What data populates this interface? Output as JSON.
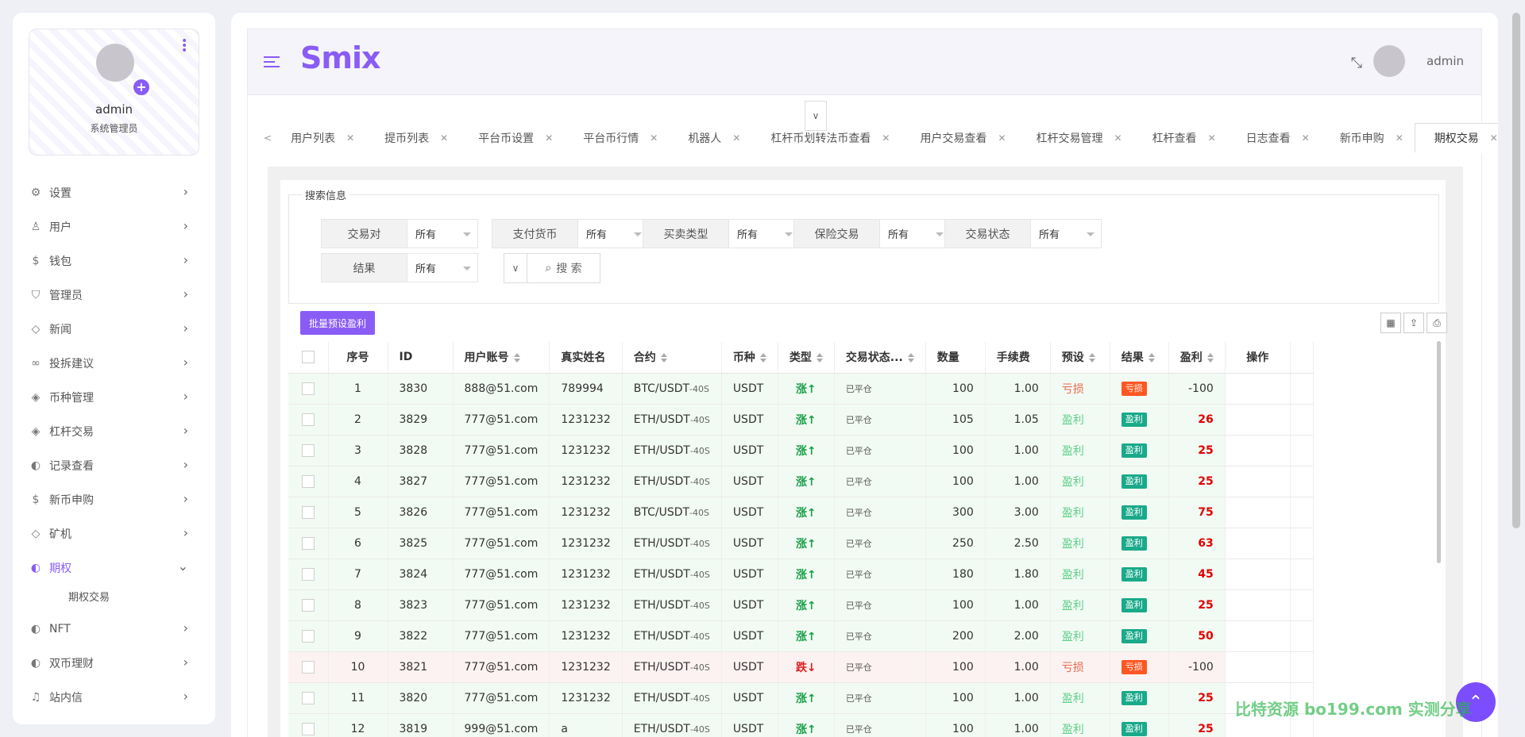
{
  "profile": {
    "name": "admin",
    "role": "系统管理员"
  },
  "menu": [
    {
      "label": "设置",
      "icon": "gear-icon",
      "glyph": "⚙",
      "active": false,
      "expanded": false
    },
    {
      "label": "用户",
      "icon": "user-icon",
      "glyph": "♙",
      "active": false,
      "expanded": false
    },
    {
      "label": "钱包",
      "icon": "dollar-icon",
      "glyph": "$",
      "active": false,
      "expanded": false
    },
    {
      "label": "管理员",
      "icon": "shield-icon",
      "glyph": "⛉",
      "active": false,
      "expanded": false
    },
    {
      "label": "新闻",
      "icon": "tag-icon",
      "glyph": "◇",
      "active": false,
      "expanded": false
    },
    {
      "label": "投拆建议",
      "icon": "infinity-icon",
      "glyph": "∞",
      "active": false,
      "expanded": false
    },
    {
      "label": "币种管理",
      "icon": "diamond-icon",
      "glyph": "◈",
      "active": false,
      "expanded": false
    },
    {
      "label": "杠杆交易",
      "icon": "diamond-icon",
      "glyph": "◈",
      "active": false,
      "expanded": false
    },
    {
      "label": "记录查看",
      "icon": "record-icon",
      "glyph": "◐",
      "active": false,
      "expanded": false
    },
    {
      "label": "新币申购",
      "icon": "dollar-icon",
      "glyph": "$",
      "active": false,
      "expanded": false
    },
    {
      "label": "矿机",
      "icon": "tag-icon",
      "glyph": "◇",
      "active": false,
      "expanded": false
    },
    {
      "label": "期权",
      "icon": "record-icon",
      "glyph": "◐",
      "active": true,
      "expanded": true,
      "children": [
        "期权交易"
      ]
    },
    {
      "label": "NFT",
      "icon": "record-icon",
      "glyph": "◐",
      "active": false,
      "expanded": false
    },
    {
      "label": "双币理财",
      "icon": "record-icon",
      "glyph": "◐",
      "active": false,
      "expanded": false
    },
    {
      "label": "站内信",
      "icon": "bell-icon",
      "glyph": "♫",
      "active": false,
      "expanded": false
    }
  ],
  "header": {
    "brand": "Smix",
    "username": "admin"
  },
  "tabs": [
    "用户列表",
    "提币列表",
    "平台币设置",
    "平台币行情",
    "机器人",
    "杠杆币划转法币查看",
    "用户交易查看",
    "杠杆交易管理",
    "杠杆查看",
    "日志查看",
    "新币申购",
    "期权交易"
  ],
  "active_tab": "期权交易",
  "search": {
    "title": "搜索信息",
    "fields": [
      {
        "label": "交易对",
        "value": "所有"
      },
      {
        "label": "支付货币",
        "value": "所有"
      },
      {
        "label": "买卖类型",
        "value": "所有"
      },
      {
        "label": "保险交易",
        "value": "所有"
      },
      {
        "label": "交易状态",
        "value": "所有"
      },
      {
        "label": "结果",
        "value": "所有"
      }
    ],
    "button": "搜 索"
  },
  "toolbar": {
    "batch_label": "批量预设盈利"
  },
  "table": {
    "columns": [
      "序号",
      "ID",
      "用户账号",
      "真实姓名",
      "合约",
      "币种",
      "类型",
      "交易状态...",
      "数量",
      "手续费",
      "预设",
      "结果",
      "盈利",
      "操作"
    ],
    "rows": [
      {
        "no": "1",
        "id": "3830",
        "account": "888@51.com",
        "name": "789994",
        "contract": "BTC/USDT",
        "period": "-40S",
        "coin": "USDT",
        "type": "涨↑",
        "dir": "up",
        "status": "已平仓",
        "qty": "100",
        "fee": "1.00",
        "preset": "亏损",
        "result": "亏损",
        "profit": "-100",
        "win": false,
        "row_tone": "win"
      },
      {
        "no": "2",
        "id": "3829",
        "account": "777@51.com",
        "name": "1231232",
        "contract": "ETH/USDT",
        "period": "-40S",
        "coin": "USDT",
        "type": "涨↑",
        "dir": "up",
        "status": "已平仓",
        "qty": "105",
        "fee": "1.05",
        "preset": "盈利",
        "result": "盈利",
        "profit": "26",
        "win": true,
        "row_tone": "win"
      },
      {
        "no": "3",
        "id": "3828",
        "account": "777@51.com",
        "name": "1231232",
        "contract": "ETH/USDT",
        "period": "-40S",
        "coin": "USDT",
        "type": "涨↑",
        "dir": "up",
        "status": "已平仓",
        "qty": "100",
        "fee": "1.00",
        "preset": "盈利",
        "result": "盈利",
        "profit": "25",
        "win": true,
        "row_tone": "win"
      },
      {
        "no": "4",
        "id": "3827",
        "account": "777@51.com",
        "name": "1231232",
        "contract": "ETH/USDT",
        "period": "-40S",
        "coin": "USDT",
        "type": "涨↑",
        "dir": "up",
        "status": "已平仓",
        "qty": "100",
        "fee": "1.00",
        "preset": "盈利",
        "result": "盈利",
        "profit": "25",
        "win": true,
        "row_tone": "win"
      },
      {
        "no": "5",
        "id": "3826",
        "account": "777@51.com",
        "name": "1231232",
        "contract": "BTC/USDT",
        "period": "-40S",
        "coin": "USDT",
        "type": "涨↑",
        "dir": "up",
        "status": "已平仓",
        "qty": "300",
        "fee": "3.00",
        "preset": "盈利",
        "result": "盈利",
        "profit": "75",
        "win": true,
        "row_tone": "win"
      },
      {
        "no": "6",
        "id": "3825",
        "account": "777@51.com",
        "name": "1231232",
        "contract": "ETH/USDT",
        "period": "-40S",
        "coin": "USDT",
        "type": "涨↑",
        "dir": "up",
        "status": "已平仓",
        "qty": "250",
        "fee": "2.50",
        "preset": "盈利",
        "result": "盈利",
        "profit": "63",
        "win": true,
        "row_tone": "win"
      },
      {
        "no": "7",
        "id": "3824",
        "account": "777@51.com",
        "name": "1231232",
        "contract": "ETH/USDT",
        "period": "-40S",
        "coin": "USDT",
        "type": "涨↑",
        "dir": "up",
        "status": "已平仓",
        "qty": "180",
        "fee": "1.80",
        "preset": "盈利",
        "result": "盈利",
        "profit": "45",
        "win": true,
        "row_tone": "win"
      },
      {
        "no": "8",
        "id": "3823",
        "account": "777@51.com",
        "name": "1231232",
        "contract": "ETH/USDT",
        "period": "-40S",
        "coin": "USDT",
        "type": "涨↑",
        "dir": "up",
        "status": "已平仓",
        "qty": "100",
        "fee": "1.00",
        "preset": "盈利",
        "result": "盈利",
        "profit": "25",
        "win": true,
        "row_tone": "win"
      },
      {
        "no": "9",
        "id": "3822",
        "account": "777@51.com",
        "name": "1231232",
        "contract": "ETH/USDT",
        "period": "-40S",
        "coin": "USDT",
        "type": "涨↑",
        "dir": "up",
        "status": "已平仓",
        "qty": "200",
        "fee": "2.00",
        "preset": "盈利",
        "result": "盈利",
        "profit": "50",
        "win": true,
        "row_tone": "win"
      },
      {
        "no": "10",
        "id": "3821",
        "account": "777@51.com",
        "name": "1231232",
        "contract": "ETH/USDT",
        "period": "-40S",
        "coin": "USDT",
        "type": "跌↓",
        "dir": "down",
        "status": "已平仓",
        "qty": "100",
        "fee": "1.00",
        "preset": "亏损",
        "result": "亏损",
        "profit": "-100",
        "win": false,
        "row_tone": "loss"
      },
      {
        "no": "11",
        "id": "3820",
        "account": "777@51.com",
        "name": "1231232",
        "contract": "ETH/USDT",
        "period": "-40S",
        "coin": "USDT",
        "type": "涨↑",
        "dir": "up",
        "status": "已平仓",
        "qty": "100",
        "fee": "1.00",
        "preset": "盈利",
        "result": "盈利",
        "profit": "25",
        "win": true,
        "row_tone": "win"
      },
      {
        "no": "12",
        "id": "3819",
        "account": "999@51.com",
        "name": "a",
        "contract": "ETH/USDT",
        "period": "-40S",
        "coin": "USDT",
        "type": "涨↑",
        "dir": "up",
        "status": "已平仓",
        "qty": "100",
        "fee": "1.00",
        "preset": "盈利",
        "result": "盈利",
        "profit": "25",
        "win": true,
        "row_tone": "win"
      }
    ]
  },
  "watermark": "比特资源 bo199.com 实测分享",
  "colors": {
    "accent": "#8a5cf6",
    "win_badge": "#1aaa8a",
    "loss_badge": "#ff5722",
    "up": "#1aa04a",
    "down": "#e02020"
  }
}
